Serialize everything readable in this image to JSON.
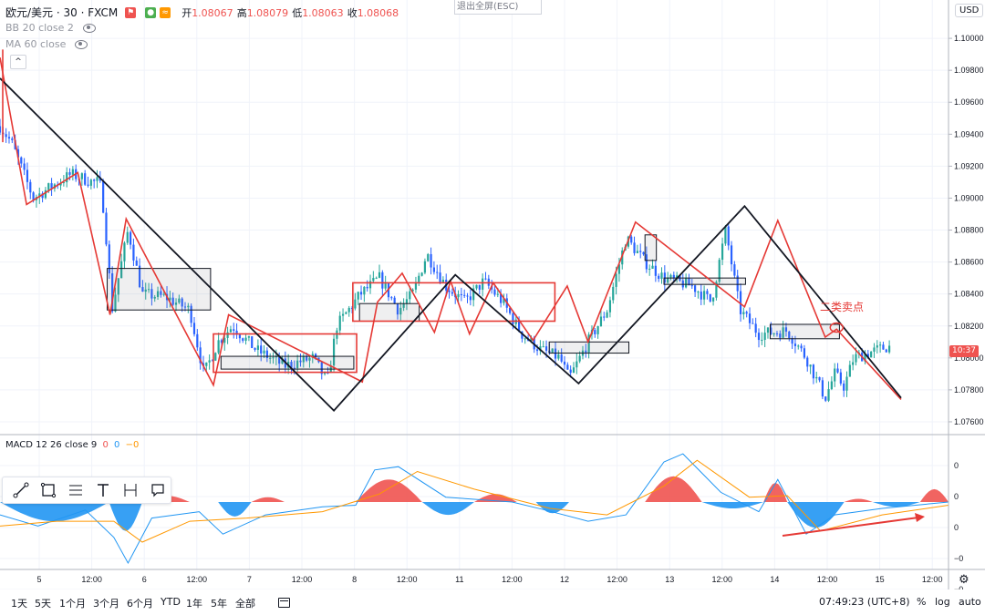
{
  "header": {
    "symbol": "欧元/美元 · 30 · FXCM",
    "ohlc": [
      {
        "label": "开",
        "value": "1.08067"
      },
      {
        "label": "高",
        "value": "1.08079"
      },
      {
        "label": "低",
        "value": "1.08063"
      },
      {
        "label": "收",
        "value": "1.08068"
      }
    ],
    "indicators": [
      "BB 20 close 2",
      "MA 60 close"
    ],
    "exit_fullscreen": "退出全屏(ESC)",
    "currency": "USD",
    "collapse_glyph": "^"
  },
  "annotation": {
    "text": "二类卖点"
  },
  "current_time_label": "10:37",
  "macd_legend": {
    "title": "MACD 12 26 close 9",
    "v1": "0",
    "v2": "0",
    "v3": "−0"
  },
  "toolbar": [
    "trend-line-icon",
    "rectangle-icon",
    "fib-icon",
    "text-icon",
    "measure-icon",
    "callout-icon"
  ],
  "bottom_bar": {
    "ranges": [
      "1天",
      "5天",
      "1个月",
      "3个月",
      "6个月",
      "YTD",
      "1年",
      "5年",
      "全部"
    ],
    "clock": "07:49:23 (UTC+8)",
    "percent": "%",
    "log": "log",
    "auto": "auto"
  },
  "colors": {
    "up": "#26a69a",
    "down": "#2962ff",
    "annotation": "#e53935",
    "macd_pos": "#ef5350",
    "macd_neg": "#2196f3",
    "macd_line": "#2196f3",
    "signal_line": "#ff9800"
  },
  "chart_data": [
    {
      "type": "candlestick",
      "title": "",
      "price_axis": {
        "ticks": [
          "1.10000",
          "1.09800",
          "1.09600",
          "1.09400",
          "1.09200",
          "1.09000",
          "1.08800",
          "1.08600",
          "1.08400",
          "1.08200",
          "1.08000",
          "1.07800",
          "1.07600"
        ],
        "range": [
          1.0752,
          1.1024
        ]
      },
      "time_axis": [
        "5",
        "12:00",
        "6",
        "12:00",
        "7",
        "12:00",
        "8",
        "12:00",
        "11",
        "12:00",
        "12",
        "12:00",
        "13",
        "12:00",
        "14",
        "12:00",
        "15",
        "12:00"
      ],
      "price_path": [
        {
          "i": 0,
          "p": 1.0945
        },
        {
          "i": 12,
          "p": 1.0935
        },
        {
          "i": 35,
          "p": 1.09
        },
        {
          "i": 75,
          "p": 1.0915
        },
        {
          "i": 98,
          "p": 1.091
        },
        {
          "i": 105,
          "p": 1.091
        },
        {
          "i": 110,
          "p": 1.089
        },
        {
          "i": 118,
          "p": 1.083
        },
        {
          "i": 135,
          "p": 1.088
        },
        {
          "i": 150,
          "p": 1.084
        },
        {
          "i": 175,
          "p": 1.0838
        },
        {
          "i": 200,
          "p": 1.083
        },
        {
          "i": 215,
          "p": 1.079
        },
        {
          "i": 230,
          "p": 1.081
        },
        {
          "i": 245,
          "p": 1.082
        },
        {
          "i": 270,
          "p": 1.0805
        },
        {
          "i": 300,
          "p": 1.0795
        },
        {
          "i": 330,
          "p": 1.08
        },
        {
          "i": 345,
          "p": 1.0785
        },
        {
          "i": 355,
          "p": 1.082
        },
        {
          "i": 380,
          "p": 1.084
        },
        {
          "i": 400,
          "p": 1.085
        },
        {
          "i": 420,
          "p": 1.083
        },
        {
          "i": 435,
          "p": 1.084
        },
        {
          "i": 450,
          "p": 1.0865
        },
        {
          "i": 470,
          "p": 1.0845
        },
        {
          "i": 490,
          "p": 1.0835
        },
        {
          "i": 510,
          "p": 1.0848
        },
        {
          "i": 530,
          "p": 1.0835
        },
        {
          "i": 550,
          "p": 1.0815
        },
        {
          "i": 570,
          "p": 1.0805
        },
        {
          "i": 590,
          "p": 1.08
        },
        {
          "i": 600,
          "p": 1.0787
        },
        {
          "i": 620,
          "p": 1.081
        },
        {
          "i": 640,
          "p": 1.083
        },
        {
          "i": 660,
          "p": 1.0875
        },
        {
          "i": 680,
          "p": 1.086
        },
        {
          "i": 700,
          "p": 1.085
        },
        {
          "i": 730,
          "p": 1.0845
        },
        {
          "i": 750,
          "p": 1.0835
        },
        {
          "i": 765,
          "p": 1.088
        },
        {
          "i": 780,
          "p": 1.083
        },
        {
          "i": 800,
          "p": 1.0815
        },
        {
          "i": 830,
          "p": 1.0817
        },
        {
          "i": 850,
          "p": 1.08
        },
        {
          "i": 870,
          "p": 1.0775
        },
        {
          "i": 880,
          "p": 1.079
        },
        {
          "i": 890,
          "p": 1.0782
        },
        {
          "i": 900,
          "p": 1.08
        },
        {
          "i": 935,
          "p": 1.0807
        }
      ],
      "red_zigzag": [
        {
          "t": 0,
          "p": 1.0988
        },
        {
          "t": 28,
          "p": 1.0896
        },
        {
          "t": 82,
          "p": 1.0916
        },
        {
          "t": 116,
          "p": 1.0827
        },
        {
          "t": 133,
          "p": 1.0887
        },
        {
          "t": 225,
          "p": 1.0783
        },
        {
          "t": 241,
          "p": 1.0827
        },
        {
          "t": 382,
          "p": 1.0785
        },
        {
          "t": 398,
          "p": 1.0835
        },
        {
          "t": 424,
          "p": 1.0853
        },
        {
          "t": 458,
          "p": 1.0816
        },
        {
          "t": 475,
          "p": 1.0848
        },
        {
          "t": 495,
          "p": 1.0815
        },
        {
          "t": 520,
          "p": 1.0847
        },
        {
          "t": 562,
          "p": 1.0811
        },
        {
          "t": 598,
          "p": 1.0845
        },
        {
          "t": 620,
          "p": 1.081
        },
        {
          "t": 670,
          "p": 1.0885
        },
        {
          "t": 785,
          "p": 1.0832
        },
        {
          "t": 820,
          "p": 1.0886
        },
        {
          "t": 870,
          "p": 1.0813
        },
        {
          "t": 882,
          "p": 1.0818
        },
        {
          "t": 950,
          "p": 1.0774
        }
      ],
      "black_zigzag": [
        {
          "t": 0,
          "p": 1.0975
        },
        {
          "t": 352,
          "p": 1.0767
        },
        {
          "t": 480,
          "p": 1.0852
        },
        {
          "t": 610,
          "p": 1.0784
        },
        {
          "t": 785,
          "p": 1.0895
        },
        {
          "t": 950,
          "p": 1.0775
        }
      ],
      "red_boxes": [
        {
          "t0": 225,
          "t1": 376,
          "p0": 1.0815,
          "p1": 1.0791
        },
        {
          "t0": 372,
          "t1": 585,
          "p0": 1.0847,
          "p1": 1.0823
        }
      ],
      "black_boxes": [
        {
          "t0": 113,
          "t1": 222,
          "p0": 1.0856,
          "p1": 1.083
        },
        {
          "t0": 233,
          "t1": 373,
          "p0": 1.0801,
          "p1": 1.0793
        },
        {
          "t0": 379,
          "t1": 442,
          "p0": 1.0834,
          "p1": 1.0823
        },
        {
          "t0": 579,
          "t1": 663,
          "p0": 1.081,
          "p1": 1.0803
        },
        {
          "t0": 680,
          "t1": 692,
          "p0": 1.0877,
          "p1": 1.0861
        },
        {
          "t0": 700,
          "t1": 786,
          "p0": 1.085,
          "p1": 1.0846
        },
        {
          "t0": 812,
          "t1": 885,
          "p0": 1.0821,
          "p1": 1.0812
        }
      ]
    },
    {
      "type": "line",
      "title": "MACD 12 26 close 9",
      "value_axis": {
        "ticks": [
          "0",
          "0",
          "0",
          "−0",
          "−0"
        ],
        "range": [
          -0.0042,
          0.0042
        ]
      },
      "series": [
        {
          "name": "MACD",
          "points": [
            {
              "t": 0,
              "v": -0.0008
            },
            {
              "t": 40,
              "v": -0.0015
            },
            {
              "t": 90,
              "v": -0.0005
            },
            {
              "t": 120,
              "v": -0.0022
            },
            {
              "t": 135,
              "v": -0.0038
            },
            {
              "t": 160,
              "v": -0.001
            },
            {
              "t": 210,
              "v": -0.0006
            },
            {
              "t": 235,
              "v": -0.002
            },
            {
              "t": 280,
              "v": -0.0008
            },
            {
              "t": 340,
              "v": -0.0003
            },
            {
              "t": 375,
              "v": -0.0002
            },
            {
              "t": 395,
              "v": 0.002
            },
            {
              "t": 420,
              "v": 0.0022
            },
            {
              "t": 470,
              "v": 0.0003
            },
            {
              "t": 540,
              "v": 0.0
            },
            {
              "t": 575,
              "v": -0.0005
            },
            {
              "t": 620,
              "v": -0.0012
            },
            {
              "t": 660,
              "v": -0.0008
            },
            {
              "t": 700,
              "v": 0.0025
            },
            {
              "t": 720,
              "v": 0.003
            },
            {
              "t": 760,
              "v": 0.0006
            },
            {
              "t": 800,
              "v": -0.0006
            },
            {
              "t": 820,
              "v": 0.0014
            },
            {
              "t": 850,
              "v": -0.002
            },
            {
              "t": 880,
              "v": -0.0008
            },
            {
              "t": 930,
              "v": -0.0004
            },
            {
              "t": 1000,
              "v": 0.0
            }
          ]
        },
        {
          "name": "Signal",
          "points": [
            {
              "t": 0,
              "v": -0.0015
            },
            {
              "t": 60,
              "v": -0.0012
            },
            {
              "t": 120,
              "v": -0.0012
            },
            {
              "t": 150,
              "v": -0.0025
            },
            {
              "t": 200,
              "v": -0.0012
            },
            {
              "t": 260,
              "v": -0.001
            },
            {
              "t": 340,
              "v": -0.0006
            },
            {
              "t": 400,
              "v": 0.0005
            },
            {
              "t": 440,
              "v": 0.0019
            },
            {
              "t": 500,
              "v": 0.0008
            },
            {
              "t": 580,
              "v": -0.0004
            },
            {
              "t": 640,
              "v": -0.0008
            },
            {
              "t": 700,
              "v": 0.001
            },
            {
              "t": 735,
              "v": 0.0026
            },
            {
              "t": 790,
              "v": 0.0003
            },
            {
              "t": 830,
              "v": 0.0004
            },
            {
              "t": 865,
              "v": -0.0018
            },
            {
              "t": 930,
              "v": -0.0008
            },
            {
              "t": 1000,
              "v": -0.0002
            }
          ]
        }
      ],
      "histogram_regions": [
        {
          "t0": 0,
          "t1": 115,
          "sign": -1,
          "amp": 0.0012
        },
        {
          "t0": 115,
          "t1": 150,
          "sign": -1,
          "amp": 0.0018
        },
        {
          "t0": 150,
          "t1": 200,
          "sign": 1,
          "amp": 0.0004
        },
        {
          "t0": 230,
          "t1": 265,
          "sign": -1,
          "amp": 0.0009
        },
        {
          "t0": 265,
          "t1": 300,
          "sign": 1,
          "amp": 0.0003
        },
        {
          "t0": 375,
          "t1": 445,
          "sign": 1,
          "amp": 0.0014
        },
        {
          "t0": 445,
          "t1": 500,
          "sign": -1,
          "amp": 0.0008
        },
        {
          "t0": 500,
          "t1": 545,
          "sign": 1,
          "amp": 0.0005
        },
        {
          "t0": 565,
          "t1": 600,
          "sign": -1,
          "amp": 0.0007
        },
        {
          "t0": 680,
          "t1": 740,
          "sign": 1,
          "amp": 0.0016
        },
        {
          "t0": 740,
          "t1": 805,
          "sign": -1,
          "amp": 0.0004
        },
        {
          "t0": 805,
          "t1": 830,
          "sign": 1,
          "amp": 0.0012
        },
        {
          "t0": 830,
          "t1": 890,
          "sign": -1,
          "amp": 0.0016
        },
        {
          "t0": 890,
          "t1": 920,
          "sign": 1,
          "amp": 0.0002
        },
        {
          "t0": 920,
          "t1": 970,
          "sign": -1,
          "amp": 0.0003
        },
        {
          "t0": 970,
          "t1": 1000,
          "sign": 1,
          "amp": 0.0008
        }
      ]
    }
  ]
}
